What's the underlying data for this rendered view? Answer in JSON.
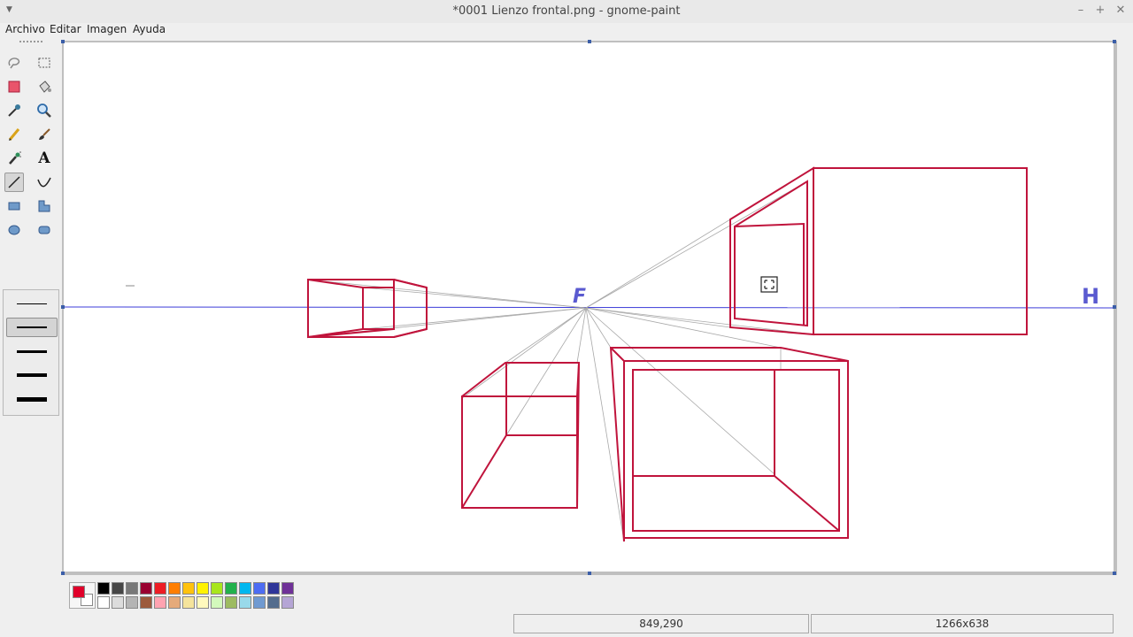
{
  "window": {
    "title": "*0001 Lienzo frontal.png - gnome-paint",
    "menu_glyph": "▼",
    "minimize": "–",
    "maximize": "+",
    "close": "✕"
  },
  "menubar": [
    "Archivo",
    "Editar",
    "Imagen",
    "Ayuda"
  ],
  "tools": [
    {
      "name": "free-select-icon"
    },
    {
      "name": "rect-select-icon"
    },
    {
      "name": "eraser-icon"
    },
    {
      "name": "fill-bucket-icon"
    },
    {
      "name": "color-picker-icon"
    },
    {
      "name": "zoom-icon"
    },
    {
      "name": "pencil-icon"
    },
    {
      "name": "paintbrush-icon"
    },
    {
      "name": "airbrush-icon"
    },
    {
      "name": "text-icon",
      "glyph": "A"
    },
    {
      "name": "line-icon",
      "active": true
    },
    {
      "name": "curve-icon"
    },
    {
      "name": "rectangle-icon"
    },
    {
      "name": "polygon-icon"
    },
    {
      "name": "ellipse-icon"
    },
    {
      "name": "rounded-rect-icon"
    }
  ],
  "line_widths": [
    {
      "weight": 1,
      "active": false
    },
    {
      "weight": 2,
      "active": true
    },
    {
      "weight": 3,
      "active": false
    },
    {
      "weight": 4,
      "active": false
    },
    {
      "weight": 5,
      "active": false
    }
  ],
  "canvas": {
    "label_f": "F",
    "label_h": "H"
  },
  "palette": {
    "foreground": "#e0002a",
    "background": "#ffffff",
    "top_row": [
      "#000000",
      "#464646",
      "#787878",
      "#990030",
      "#ed1c24",
      "#ff7e00",
      "#ffc20e",
      "#fff200",
      "#a8e61d",
      "#22b14c",
      "#00b7ef",
      "#4d6df3",
      "#2f3699",
      "#6f3198"
    ],
    "bottom_row": [
      "#ffffff",
      "#dcdcdc",
      "#b4b4b4",
      "#9c5a3c",
      "#ffa3b1",
      "#e5aa7a",
      "#f5e49c",
      "#fff9bd",
      "#d3f9bc",
      "#9dbb61",
      "#99d9ea",
      "#709ad1",
      "#546d8e",
      "#b5a5d5"
    ]
  },
  "status": {
    "coordinates": "849,290",
    "dimensions": "1266x638"
  },
  "colors": {
    "drawing": "#c0143c",
    "horizon": "#3c3cd8",
    "guide": "#a0a0a0",
    "labels": "#5a5ad0"
  }
}
